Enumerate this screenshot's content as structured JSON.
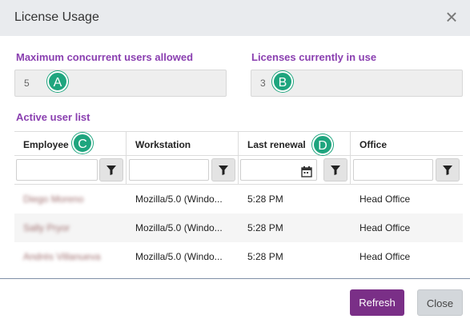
{
  "dialog": {
    "title": "License Usage",
    "close_icon": "close-icon"
  },
  "fields": {
    "max_users": {
      "label": "Maximum concurrent users allowed",
      "value": "5",
      "badge": "A"
    },
    "in_use": {
      "label": "Licenses currently in use",
      "value": "3",
      "badge": "B"
    }
  },
  "active_list": {
    "label": "Active user list",
    "columns": [
      "Employee",
      "Workstation",
      "Last renewal",
      "Office"
    ],
    "badge_c": "C",
    "badge_d": "D",
    "rows": [
      {
        "employee": "Diego Moreno",
        "workstation": "Mozilla/5.0 (Windo...",
        "last_renewal": "5:28 PM",
        "office": "Head Office"
      },
      {
        "employee": "Sally Pryor",
        "workstation": "Mozilla/5.0 (Windo...",
        "last_renewal": "5:28 PM",
        "office": "Head Office"
      },
      {
        "employee": "Andrés Villanueva",
        "workstation": "Mozilla/5.0 (Windo...",
        "last_renewal": "5:28 PM",
        "office": "Head Office"
      }
    ]
  },
  "footer": {
    "refresh_label": "Refresh",
    "close_label": "Close"
  },
  "colors": {
    "accent_purple": "#8a3fb0",
    "refresh_button": "#7a2f87",
    "badge_green": "#1ea57e"
  }
}
